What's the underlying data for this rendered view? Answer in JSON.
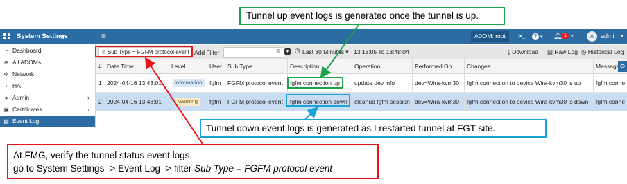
{
  "topbar": {
    "title": "System Settings",
    "adom": "ADOM: root",
    "notification_count": "1",
    "avatar_initial": "A",
    "user": "admin"
  },
  "sidebar": {
    "items": [
      {
        "label": "Dashboard",
        "icon": "dashboard-icon"
      },
      {
        "label": "All ADOMs",
        "icon": "globe-icon"
      },
      {
        "label": "Network",
        "icon": "network-icon"
      },
      {
        "label": "HA",
        "icon": "ha-icon"
      },
      {
        "label": "Admin",
        "icon": "user-icon"
      },
      {
        "label": "Certificates",
        "icon": "certificate-icon"
      },
      {
        "label": "Event Log",
        "icon": "list-icon"
      }
    ]
  },
  "toolbar": {
    "filter_chip": "Sub Type = FGFM protocol event",
    "add_filter": "Add Filter",
    "time_range": "Last 30 Minutes",
    "time_window": "13:18:05 To 13:48:04",
    "download": "Download",
    "raw_log": "Raw Log",
    "historical_log": "Historical Log"
  },
  "table": {
    "columns": [
      "#",
      "Date Time",
      "Level",
      "User",
      "Sub Type",
      "Description",
      "Operation",
      "Performed On",
      "Changes",
      "Message"
    ],
    "rows": [
      [
        "1",
        "2024-04-16 13:43:01",
        "information",
        "fgfm",
        "FGFM protocol event",
        "fgfm connection up",
        "update dev info",
        "dev=Wira-kvm30",
        "fgfm connection to device Wira-kvm30 is up",
        "fgfm conne"
      ],
      [
        "2",
        "2024-04-16 13:43:01",
        "warning",
        "fgfm",
        "FGFM protocol event",
        "fgfm connection down",
        "cleanup fgfm session",
        "dev=Wira-kvm30",
        "fgfm connection to device Wira-kvm30 is down",
        "fgfm conne"
      ]
    ]
  },
  "annotations": {
    "up": "Tunnel up event logs is generated once the tunnel is up.",
    "down": "Tunnel down event logs is generated as I restarted tunnel at FGT site.",
    "fmg_line1": "At FMG, verify the tunnel status event logs.",
    "fmg_line2_prefix": "go to System Settings -> Event Log -> filter ",
    "fmg_line2_italic": "Sub Type = FGFM protocol event"
  },
  "colors": {
    "header_blue": "#2d6ca2",
    "green": "#1aa34a",
    "red": "#e8141c",
    "cyan": "#1aa3d8",
    "selected_row": "#c9ddf2",
    "info_badge": "#dbe8f5",
    "warn_badge": "#f7ecc6"
  }
}
